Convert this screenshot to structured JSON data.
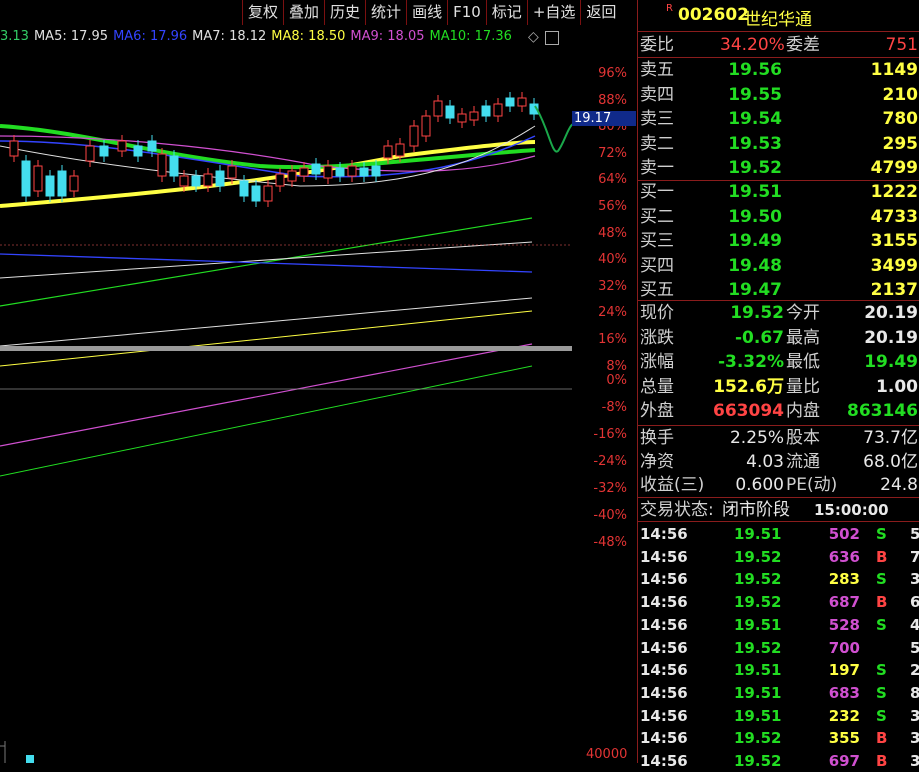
{
  "toolbar": [
    "复权",
    "叠加",
    "历史",
    "统计",
    "画线",
    "F10",
    "标记",
    "+自选",
    "返回"
  ],
  "ma": [
    {
      "label": "3.13",
      "color": "#33cc66"
    },
    {
      "label": "MA5: 17.95",
      "color": "#e0e0e0"
    },
    {
      "label": "MA6: 17.96",
      "color": "#3344ff"
    },
    {
      "label": "MA7: 18.12",
      "color": "#e0e0e0"
    },
    {
      "label": "MA8: 18.50",
      "color": "#ffff44"
    },
    {
      "label": "MA9: 18.05",
      "color": "#d050d0"
    },
    {
      "label": "MA10: 17.36",
      "color": "#22dd22"
    }
  ],
  "axis": [
    "96%",
    "88%",
    "80%",
    "72%",
    "64%",
    "56%",
    "48%",
    "40%",
    "32%",
    "24%",
    "16%",
    "8%",
    "0%",
    "-8%",
    "-16%",
    "-24%",
    "-32%",
    "-40%",
    "-48%"
  ],
  "price_tag": "19.17",
  "volume_label": "40000",
  "stock": {
    "badge": "R",
    "code": "002602",
    "name": "世纪华通"
  },
  "weibi": {
    "l1": "委比",
    "v1": "34.20%",
    "l2": "委差",
    "v2": "751"
  },
  "sell": [
    {
      "l": "卖五",
      "p": "19.56",
      "v": "1149"
    },
    {
      "l": "卖四",
      "p": "19.55",
      "v": "210"
    },
    {
      "l": "卖三",
      "p": "19.54",
      "v": "780"
    },
    {
      "l": "卖二",
      "p": "19.53",
      "v": "295"
    },
    {
      "l": "卖一",
      "p": "19.52",
      "v": "4799"
    }
  ],
  "buy": [
    {
      "l": "买一",
      "p": "19.51",
      "v": "1222"
    },
    {
      "l": "买二",
      "p": "19.50",
      "v": "4733"
    },
    {
      "l": "买三",
      "p": "19.49",
      "v": "3155"
    },
    {
      "l": "买四",
      "p": "19.48",
      "v": "3499"
    },
    {
      "l": "买五",
      "p": "19.47",
      "v": "2137"
    }
  ],
  "quote": [
    {
      "l1": "现价",
      "v1": "19.52",
      "c1": "green",
      "l2": "今开",
      "v2": "20.19",
      "c2": "white"
    },
    {
      "l1": "涨跌",
      "v1": "-0.67",
      "c1": "green",
      "l2": "最高",
      "v2": "20.19",
      "c2": "white"
    },
    {
      "l1": "涨幅",
      "v1": "-3.32%",
      "c1": "green",
      "l2": "最低",
      "v2": "19.49",
      "c2": "green"
    },
    {
      "l1": "总量",
      "v1": "152.6万",
      "c1": "yellow",
      "l2": "量比",
      "v2": "1.00",
      "c2": "white"
    },
    {
      "l1": "外盘",
      "v1": "663094",
      "c1": "red",
      "l2": "内盘",
      "v2": "863146",
      "c2": "green"
    }
  ],
  "info": [
    {
      "l1": "换手",
      "v1": "2.25%",
      "l2": "股本",
      "v2": "73.7亿"
    },
    {
      "l1": "净资",
      "v1": "4.03",
      "l2": "流通",
      "v2": "68.0亿"
    },
    {
      "l1": "收益(三)",
      "v1": "0.600",
      "l2": "PE(动)",
      "v2": "24.8"
    }
  ],
  "trade_status": {
    "label": "交易状态:",
    "value": "闭市阶段",
    "time": "15:00:00"
  },
  "trades": [
    {
      "t": "14:56",
      "p": "19.51",
      "v": "502",
      "vc": "#d050d0",
      "s": "S",
      "sc": "#22dd22",
      "x": "5"
    },
    {
      "t": "14:56",
      "p": "19.52",
      "v": "636",
      "vc": "#d050d0",
      "s": "B",
      "sc": "#ff4444",
      "x": "7"
    },
    {
      "t": "14:56",
      "p": "19.52",
      "v": "283",
      "vc": "#ffff44",
      "s": "S",
      "sc": "#22dd22",
      "x": "3"
    },
    {
      "t": "14:56",
      "p": "19.52",
      "v": "687",
      "vc": "#d050d0",
      "s": "B",
      "sc": "#ff4444",
      "x": "6"
    },
    {
      "t": "14:56",
      "p": "19.51",
      "v": "528",
      "vc": "#d050d0",
      "s": "S",
      "sc": "#22dd22",
      "x": "4"
    },
    {
      "t": "14:56",
      "p": "19.52",
      "v": "700",
      "vc": "#d050d0",
      "s": "",
      "sc": "#22dd22",
      "x": "5"
    },
    {
      "t": "14:56",
      "p": "19.51",
      "v": "197",
      "vc": "#ffff44",
      "s": "S",
      "sc": "#22dd22",
      "x": "2"
    },
    {
      "t": "14:56",
      "p": "19.51",
      "v": "683",
      "vc": "#d050d0",
      "s": "S",
      "sc": "#22dd22",
      "x": "8"
    },
    {
      "t": "14:56",
      "p": "19.51",
      "v": "232",
      "vc": "#ffff44",
      "s": "S",
      "sc": "#22dd22",
      "x": "3"
    },
    {
      "t": "14:56",
      "p": "19.52",
      "v": "355",
      "vc": "#ffff44",
      "s": "B",
      "sc": "#ff4444",
      "x": "3"
    },
    {
      "t": "14:56",
      "p": "19.52",
      "v": "697",
      "vc": "#d050d0",
      "s": "B",
      "sc": "#ff4444",
      "x": "3"
    }
  ]
}
